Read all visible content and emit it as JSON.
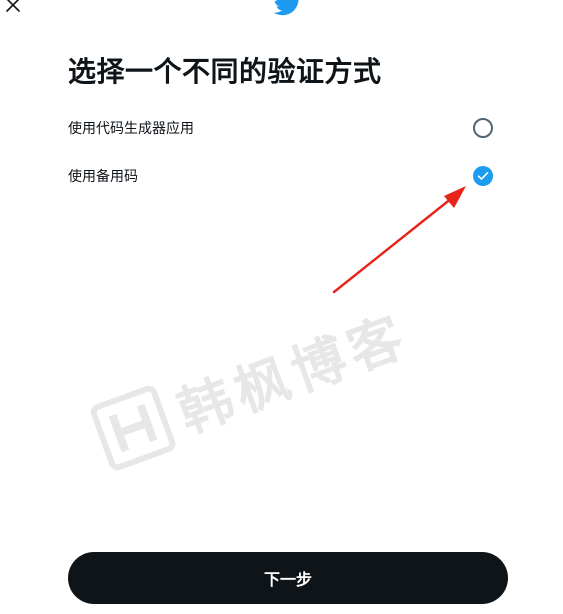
{
  "header": {
    "close_icon": "close-icon",
    "logo_icon": "twitter-bird-icon"
  },
  "title": "选择一个不同的验证方式",
  "options": [
    {
      "label": "使用代码生成器应用",
      "selected": false
    },
    {
      "label": "使用备用码",
      "selected": true
    }
  ],
  "next_button": "下一步",
  "watermark": "韩枫博客",
  "colors": {
    "accent": "#1d9bf0",
    "text": "#0f1419",
    "button_bg": "#0f1419",
    "radio_border": "#536471",
    "annotation_arrow": "#e8231a"
  }
}
